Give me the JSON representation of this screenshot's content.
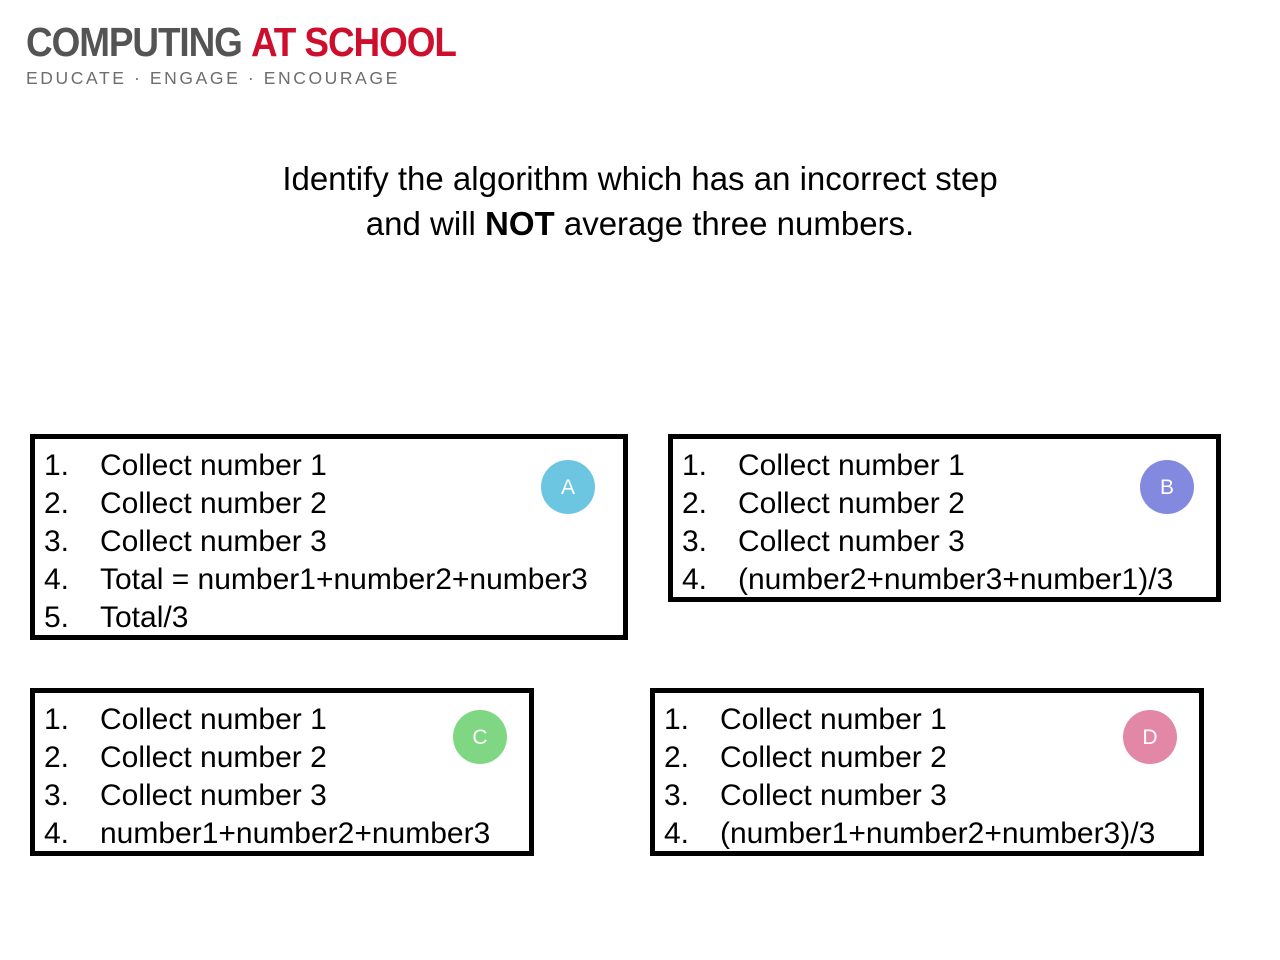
{
  "logo": {
    "wordmark_part_1": "COMPUTING",
    "wordmark_part_2": "AT SCHOOL",
    "tagline": "EDUCATE · ENGAGE · ENCOURAGE",
    "color_part_1": "#545454",
    "color_part_2": "#ce0e2d",
    "color_tagline": "#6e6e6e"
  },
  "question": {
    "line_1": "Identify the algorithm which has an incorrect step",
    "line_2_before": "and will ",
    "line_2_emphasis": "NOT",
    "line_2_after": " average three numbers."
  },
  "options": [
    {
      "id": "A",
      "badge_label": "A",
      "badge_color": "#6cc6e2",
      "steps": [
        {
          "num": "1.",
          "text": "Collect number 1"
        },
        {
          "num": "2.",
          "text": "Collect number 2"
        },
        {
          "num": "3.",
          "text": "Collect number 3"
        },
        {
          "num": "4.",
          "text": "Total = number1+number2+number3"
        },
        {
          "num": "5.",
          "text": "Total/3"
        }
      ]
    },
    {
      "id": "B",
      "badge_label": "B",
      "badge_color": "#8289de",
      "steps": [
        {
          "num": "1.",
          "text": "Collect number 1"
        },
        {
          "num": "2.",
          "text": "Collect number 2"
        },
        {
          "num": "3.",
          "text": "Collect number 3"
        },
        {
          "num": "4.",
          "text": "(number2+number3+number1)/3"
        }
      ]
    },
    {
      "id": "C",
      "badge_label": "C",
      "badge_color": "#7fd783",
      "steps": [
        {
          "num": "1.",
          "text": "Collect number 1"
        },
        {
          "num": "2.",
          "text": "Collect number 2"
        },
        {
          "num": "3.",
          "text": "Collect number 3"
        },
        {
          "num": "4.",
          "text": "number1+number2+number3"
        }
      ]
    },
    {
      "id": "D",
      "badge_label": "D",
      "badge_color": "#e288a6",
      "steps": [
        {
          "num": "1.",
          "text": "Collect number 1"
        },
        {
          "num": "2.",
          "text": "Collect number 2"
        },
        {
          "num": "3.",
          "text": "Collect number 3"
        },
        {
          "num": "4.",
          "text": "(number1+number2+number3)/3"
        }
      ]
    }
  ]
}
